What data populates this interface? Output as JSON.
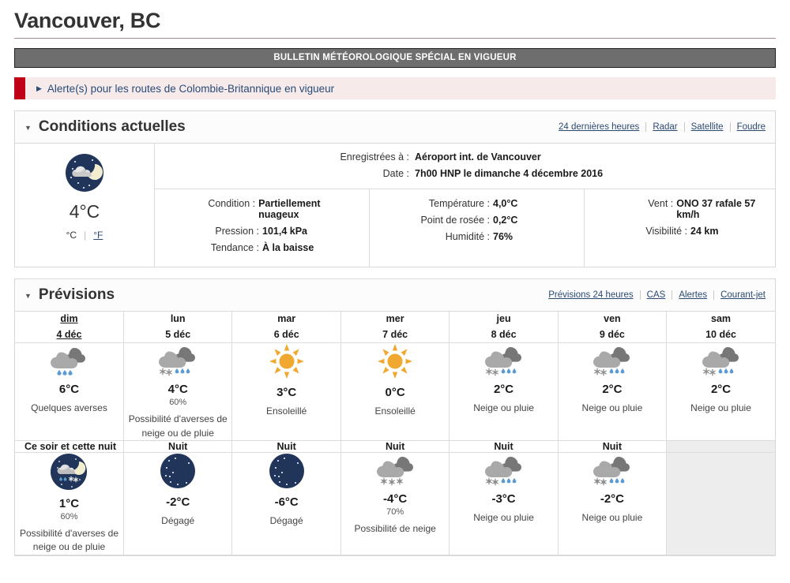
{
  "page": {
    "title": "Vancouver, BC"
  },
  "bulletin": {
    "text": "BULLETIN MÉTÉOROLOGIQUE SPÉCIAL EN VIGUEUR",
    "bg_color": "#6e6e6e"
  },
  "alert": {
    "arrow": "play-right-icon",
    "text": "Alerte(s) pour les routes de Colombie-Britannique en vigueur",
    "flag_color": "#c00017",
    "bg_color": "#f7eaea",
    "link_color": "#284b78"
  },
  "current_conditions": {
    "heading": "Conditions actuelles",
    "caret": "caret-down-icon",
    "links": [
      {
        "label": "24 dernières heures"
      },
      {
        "label": "Radar"
      },
      {
        "label": "Satellite"
      },
      {
        "label": "Foudre"
      }
    ],
    "icon": "night-partly-cloudy-icon",
    "temperature": "4°C",
    "unit_current": "°C",
    "unit_toggle": "°F",
    "meta": [
      {
        "label": "Enregistrées à :",
        "value": "Aéroport int. de Vancouver"
      },
      {
        "label": "Date :",
        "value": "7h00 HNP le dimanche 4 décembre 2016"
      }
    ],
    "columns": [
      [
        {
          "label": "Condition :",
          "value": "Partiellement nuageux"
        },
        {
          "label": "Pression :",
          "value": "101,4 kPa"
        },
        {
          "label": "Tendance :",
          "value": "À la baisse"
        }
      ],
      [
        {
          "label": "Température :",
          "value": "4,0°C"
        },
        {
          "label": "Point de rosée :",
          "value": "0,2°C"
        },
        {
          "label": "Humidité :",
          "value": "76%"
        }
      ],
      [
        {
          "label": "Vent :",
          "value": "ONO 37 rafale 57 km/h"
        },
        {
          "label": "Visibilité :",
          "value": "24 km"
        }
      ]
    ]
  },
  "forecast": {
    "heading": "Prévisions",
    "caret": "caret-down-icon",
    "links": [
      {
        "label": "Prévisions 24 heures"
      },
      {
        "label": "CAS"
      },
      {
        "label": "Alertes"
      },
      {
        "label": "Courant-jet"
      }
    ],
    "days": [
      {
        "weekday": "dim",
        "date": "4 déc",
        "is_link": true
      },
      {
        "weekday": "lun",
        "date": "5 déc",
        "is_link": false
      },
      {
        "weekday": "mar",
        "date": "6 déc",
        "is_link": false
      },
      {
        "weekday": "mer",
        "date": "7 déc",
        "is_link": false
      },
      {
        "weekday": "jeu",
        "date": "8 déc",
        "is_link": false
      },
      {
        "weekday": "ven",
        "date": "9 déc",
        "is_link": false
      },
      {
        "weekday": "sam",
        "date": "10 déc",
        "is_link": false
      }
    ],
    "day_forecasts": [
      {
        "icon": "rain-showers-icon",
        "temp": "6°C",
        "pop": "",
        "summary": "Quelques averses"
      },
      {
        "icon": "snow-rain-mix-icon",
        "temp": "4°C",
        "pop": "60%",
        "summary": "Possibilité d'averses de neige ou de pluie"
      },
      {
        "icon": "sunny-icon",
        "temp": "3°C",
        "pop": "",
        "summary": "Ensoleillé"
      },
      {
        "icon": "sunny-icon",
        "temp": "0°C",
        "pop": "",
        "summary": "Ensoleillé"
      },
      {
        "icon": "snow-rain-mix-icon",
        "temp": "2°C",
        "pop": "",
        "summary": "Neige ou pluie"
      },
      {
        "icon": "snow-rain-mix-icon",
        "temp": "2°C",
        "pop": "",
        "summary": "Neige ou pluie"
      },
      {
        "icon": "snow-rain-mix-icon",
        "temp": "2°C",
        "pop": "",
        "summary": "Neige ou pluie"
      }
    ],
    "night_headers": [
      "Ce soir et cette nuit",
      "Nuit",
      "Nuit",
      "Nuit",
      "Nuit",
      "Nuit",
      ""
    ],
    "night_forecasts": [
      {
        "icon": "night-rain-snow-icon",
        "temp": "1°C",
        "pop": "60%",
        "summary": "Possibilité d'averses de neige ou de pluie"
      },
      {
        "icon": "clear-night-icon",
        "temp": "-2°C",
        "pop": "",
        "summary": "Dégagé"
      },
      {
        "icon": "clear-night-icon",
        "temp": "-6°C",
        "pop": "",
        "summary": "Dégagé"
      },
      {
        "icon": "snow-icon",
        "temp": "-4°C",
        "pop": "70%",
        "summary": "Possibilité de neige"
      },
      {
        "icon": "snow-rain-mix-icon",
        "temp": "-3°C",
        "pop": "",
        "summary": "Neige ou pluie"
      },
      {
        "icon": "snow-rain-mix-icon",
        "temp": "-2°C",
        "pop": "",
        "summary": "Neige ou pluie"
      },
      {
        "icon": "",
        "temp": "",
        "pop": "",
        "summary": ""
      }
    ]
  },
  "colors": {
    "link": "#2b4a73",
    "sun": "#f0a830",
    "cloud_light": "#a9a9a9",
    "cloud_dark": "#777777",
    "rain": "#5b9bd5",
    "night_circle": "#21355a",
    "moon": "#f2edcf"
  }
}
